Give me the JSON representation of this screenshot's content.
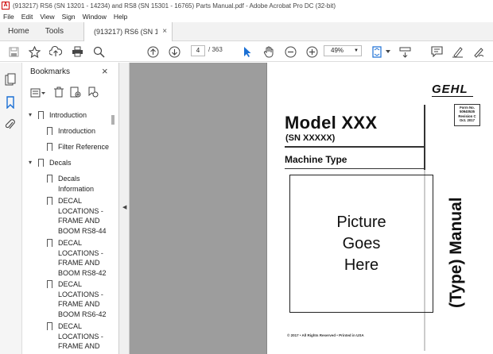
{
  "window": {
    "title": "(913217) RS6 (SN 13201 - 14234) and RS8 (SN 15301 - 16765) Parts Manual.pdf - Adobe Acrobat Pro DC (32-bit)",
    "app_icon": "A"
  },
  "menu": {
    "items": [
      "File",
      "Edit",
      "View",
      "Sign",
      "Window",
      "Help"
    ]
  },
  "tabs": {
    "home": "Home",
    "tools": "Tools",
    "document": "(913217) RS6 (SN 1...",
    "close": "×"
  },
  "toolbar": {
    "page_current": "4",
    "page_total": "/ 363",
    "zoom": "49%"
  },
  "bookmarks": {
    "header": "Bookmarks",
    "close": "×",
    "items": [
      {
        "label": "Introduction",
        "level": 0,
        "expanded": true
      },
      {
        "label": "Introduction",
        "level": 1
      },
      {
        "label": "Filter Reference",
        "level": 1
      },
      {
        "label": "Decals",
        "level": 0,
        "expanded": true
      },
      {
        "label": "Decals\nInformation",
        "level": 1
      },
      {
        "label": "DECAL\nLOCATIONS -\nFRAME AND\nBOOM  RS8-44",
        "level": 1
      },
      {
        "label": "DECAL\nLOCATIONS -\nFRAME AND\nBOOM RS8-42",
        "level": 1
      },
      {
        "label": "DECAL\nLOCATIONS -\nFRAME AND\nBOOM  RS6-42",
        "level": 1
      },
      {
        "label": "DECAL\nLOCATIONS -\nFRAME AND",
        "level": 1
      }
    ]
  },
  "pdf_page": {
    "brand": "GEHL",
    "form_box": "Form No.\n50940535\nRevision C\nOct. 2017",
    "model": "Model XXX",
    "sn": "(SN XXXXX)",
    "machine_type": "Machine Type",
    "picture_placeholder": "Picture\nGoes\nHere",
    "vertical_title": "(Type) Manual",
    "copyright": "© 2017 • All Rights Reserved • Printed in USA"
  }
}
